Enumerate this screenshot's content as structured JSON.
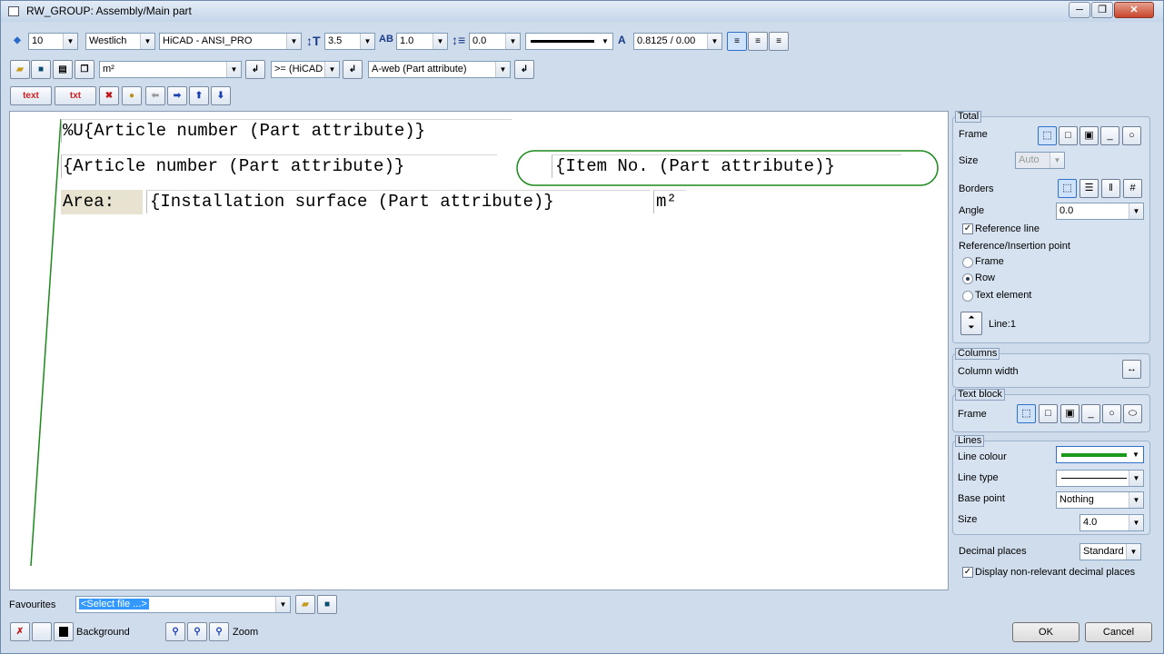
{
  "window": {
    "title": "RW_GROUP: Assembly/Main part",
    "minimize": "─",
    "restore": "❐",
    "close": "✕"
  },
  "toolbar1": {
    "font_size": "10",
    "font_name": "Westlich",
    "standard": "HiCAD - ANSI_PRO",
    "text_height": "3.5",
    "width_ratio": "1.0",
    "line_spacing": "0.0",
    "line_style": "",
    "char_spacing": "0.8125 / 0.00"
  },
  "toolbar2": {
    "unit_value": "m²",
    "operator_value": ">= (HiCAD",
    "attribute_value": "A-web (Part attribute)"
  },
  "toolbar3": {
    "text_btn": "text",
    "txt_btn": "txt"
  },
  "canvas": {
    "line1": "%U{Article number (Part attribute)}",
    "line2a": "{Article number (Part attribute)}",
    "line2b": "{Item No. (Part attribute)}",
    "line3_label": "Area:",
    "line3_value": "{Installation surface (Part attribute)}",
    "line3_unit": "m²"
  },
  "total": {
    "title": "Total",
    "frame_label": "Frame",
    "size_label": "Size",
    "size_value": "Auto",
    "borders_label": "Borders",
    "angle_label": "Angle",
    "angle_value": "0.0",
    "reference_line_label": "Reference line",
    "ref_point_label": "Reference/Insertion point",
    "radio_frame": "Frame",
    "radio_row": "Row",
    "radio_text_element": "Text element",
    "line_label": "Line:1"
  },
  "columns": {
    "title": "Columns",
    "column_width_label": "Column width"
  },
  "textblock": {
    "title": "Text block",
    "frame_label": "Frame"
  },
  "lines": {
    "title": "Lines",
    "line_colour_label": "Line colour",
    "line_colour": "#1a9a1a",
    "line_type_label": "Line type",
    "base_point_label": "Base point",
    "base_point_value": "Nothing",
    "size_label": "Size",
    "size_value": "4.0"
  },
  "decimal": {
    "label": "Decimal places",
    "value": "Standard",
    "display_label": "Display non-relevant decimal places"
  },
  "favourites": {
    "label": "Favourites",
    "value": "<Select file ...>"
  },
  "bottom": {
    "background_label": "Background",
    "zoom_label": "Zoom",
    "ok": "OK",
    "cancel": "Cancel"
  }
}
